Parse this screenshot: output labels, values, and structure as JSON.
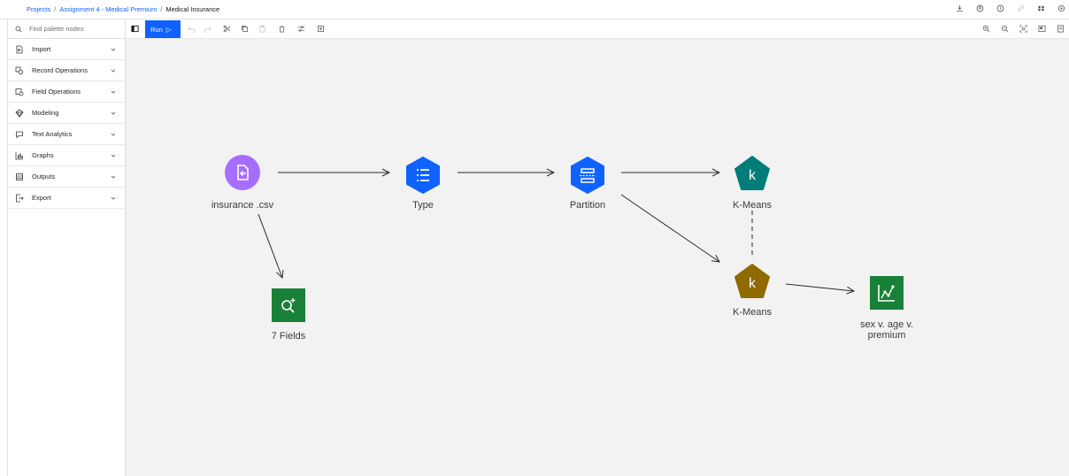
{
  "breadcrumb": {
    "items": [
      "Projects",
      "Assignment 4 - Medical Premium"
    ],
    "current": "Medical Insurance",
    "separator": "/"
  },
  "header_icons": [
    "download-icon",
    "user-icon",
    "history-icon",
    "edit-icon",
    "grid-icon",
    "settings-icon"
  ],
  "palette": {
    "search_placeholder": "Find palette nodes",
    "items": [
      {
        "label": "Import",
        "icon": "import-icon"
      },
      {
        "label": "Record Operations",
        "icon": "record-operations-icon"
      },
      {
        "label": "Field Operations",
        "icon": "field-operations-icon"
      },
      {
        "label": "Modeling",
        "icon": "modeling-icon"
      },
      {
        "label": "Text Analytics",
        "icon": "text-analytics-icon"
      },
      {
        "label": "Graphs",
        "icon": "graphs-icon"
      },
      {
        "label": "Outputs",
        "icon": "outputs-icon"
      },
      {
        "label": "Export",
        "icon": "export-icon"
      }
    ]
  },
  "toolbar": {
    "run_label": "Run",
    "tools": [
      "palette-toggle-icon",
      "undo-icon",
      "redo-icon",
      "cut-icon",
      "copy-icon",
      "paste-icon",
      "delete-icon",
      "settings-sliders-icon",
      "cache-icon"
    ],
    "zoom_tools": [
      "zoom-in-icon",
      "zoom-out-icon",
      "fit-to-screen-icon",
      "minimap-icon",
      "properties-icon"
    ]
  },
  "flow": {
    "nodes": [
      {
        "id": "insurance",
        "label": "insurance .csv",
        "type": "data-asset",
        "color": "#a56eff",
        "shape": "circle"
      },
      {
        "id": "type",
        "label": "Type",
        "type": "field-op",
        "color": "#0f62fe",
        "shape": "hexagon"
      },
      {
        "id": "partition",
        "label": "Partition",
        "type": "field-op",
        "color": "#0f62fe",
        "shape": "hexagon"
      },
      {
        "id": "kmeans1",
        "label": "K-Means",
        "type": "model",
        "color": "#007d79",
        "shape": "pentagon"
      },
      {
        "id": "kmeans2",
        "label": "K-Means",
        "type": "model-nugget",
        "color": "#8e6a00",
        "shape": "pentagon"
      },
      {
        "id": "fields",
        "label": "7 Fields",
        "type": "output",
        "color": "#198038",
        "shape": "square"
      },
      {
        "id": "plot",
        "label": "sex v. age v. premium",
        "type": "graph",
        "color": "#198038",
        "shape": "square"
      }
    ],
    "links": [
      {
        "from": "insurance",
        "to": "type"
      },
      {
        "from": "type",
        "to": "partition"
      },
      {
        "from": "partition",
        "to": "kmeans1"
      },
      {
        "from": "partition",
        "to": "kmeans2"
      },
      {
        "from": "insurance",
        "to": "fields"
      },
      {
        "from": "kmeans2",
        "to": "plot"
      },
      {
        "from": "kmeans1",
        "to": "kmeans2",
        "style": "dashed"
      }
    ],
    "node_glyphs": {
      "kmeans": "k"
    }
  }
}
